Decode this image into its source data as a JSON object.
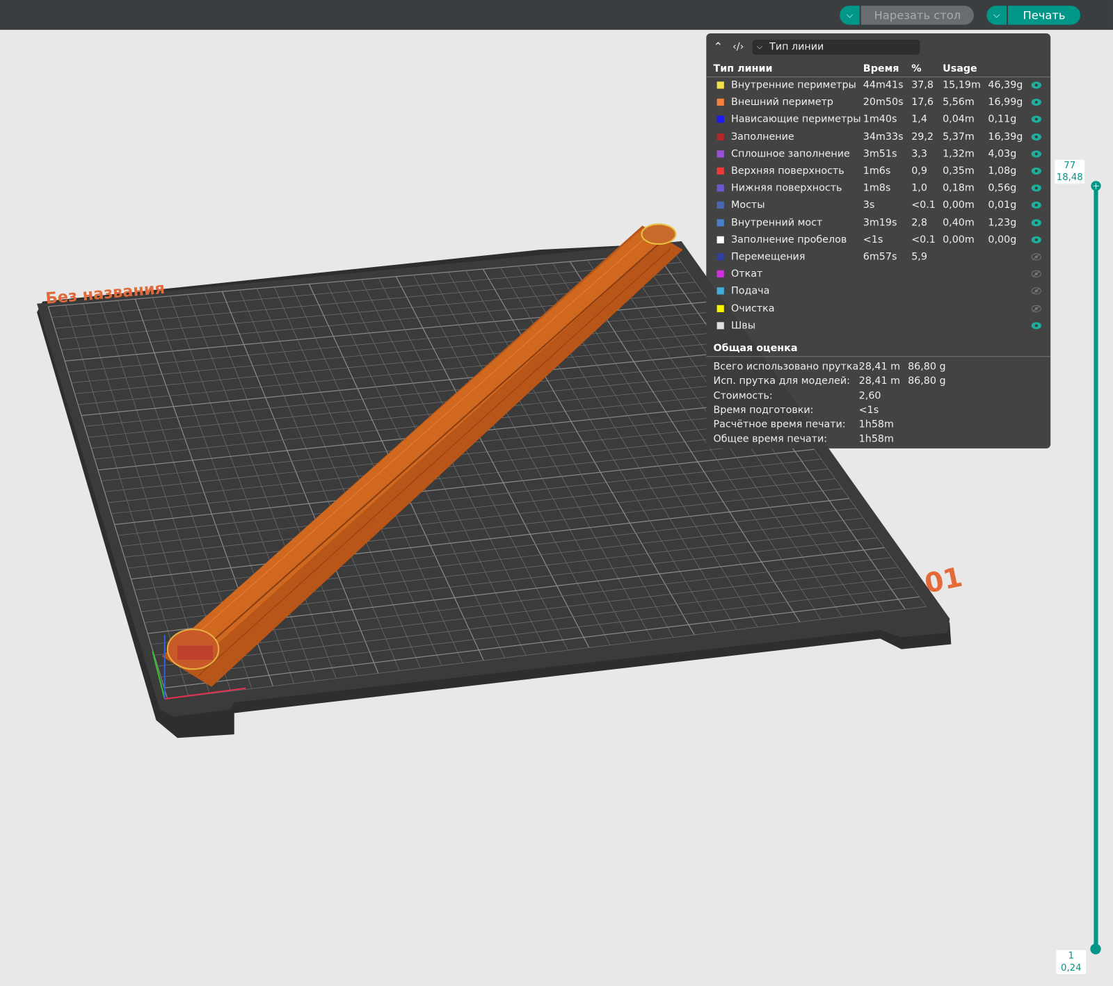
{
  "topbar": {
    "slice_label": "Нарезать стол",
    "print_label": "Печать"
  },
  "plate": {
    "name": "Без названия",
    "number": "01"
  },
  "legend": {
    "view_type": "Тип линии",
    "headers": {
      "type": "Тип линии",
      "time": "Время",
      "percent": "%",
      "usage": "Usage"
    },
    "rows": [
      {
        "color": "#f5e04a",
        "name": "Внутренние периметры",
        "time": "44m41s",
        "percent": "37,8",
        "length": "15,19m",
        "weight": "46,39g",
        "visible": true
      },
      {
        "color": "#f5813a",
        "name": "Внешний периметр",
        "time": "20m50s",
        "percent": "17,6",
        "length": "5,56m",
        "weight": "16,99g",
        "visible": true
      },
      {
        "color": "#1a1af5",
        "name": "Нависающие периметры",
        "time": "1m40s",
        "percent": "1,4",
        "length": "0,04m",
        "weight": "0,11g",
        "visible": true
      },
      {
        "color": "#b02828",
        "name": "Заполнение",
        "time": "34m33s",
        "percent": "29,2",
        "length": "5,37m",
        "weight": "16,39g",
        "visible": true
      },
      {
        "color": "#9a50d8",
        "name": "Сплошное заполнение",
        "time": "3m51s",
        "percent": "3,3",
        "length": "1,32m",
        "weight": "4,03g",
        "visible": true
      },
      {
        "color": "#f03a3a",
        "name": "Верхняя поверхность",
        "time": "1m6s",
        "percent": "0,9",
        "length": "0,35m",
        "weight": "1,08g",
        "visible": true
      },
      {
        "color": "#6a5ad0",
        "name": "Нижняя поверхность",
        "time": "1m8s",
        "percent": "1,0",
        "length": "0,18m",
        "weight": "0,56g",
        "visible": true
      },
      {
        "color": "#4a68b0",
        "name": "Мосты",
        "time": "3s",
        "percent": "<0.1",
        "length": "0,00m",
        "weight": "0,01g",
        "visible": true
      },
      {
        "color": "#4a80c8",
        "name": "Внутренний мост",
        "time": "3m19s",
        "percent": "2,8",
        "length": "0,40m",
        "weight": "1,23g",
        "visible": true
      },
      {
        "color": "#ffffff",
        "name": "Заполнение пробелов",
        "time": "<1s",
        "percent": "<0.1",
        "length": "0,00m",
        "weight": "0,00g",
        "visible": true
      },
      {
        "color": "#3040a0",
        "name": "Перемещения",
        "time": "6m57s",
        "percent": "5,9",
        "length": "",
        "weight": "",
        "visible": false
      },
      {
        "color": "#d030e0",
        "name": "Откат",
        "time": "",
        "percent": "",
        "length": "",
        "weight": "",
        "visible": false
      },
      {
        "color": "#40b0d8",
        "name": "Подача",
        "time": "",
        "percent": "",
        "length": "",
        "weight": "",
        "visible": false
      },
      {
        "color": "#f5f500",
        "name": "Очистка",
        "time": "",
        "percent": "",
        "length": "",
        "weight": "",
        "visible": false
      },
      {
        "color": "#e0e0e0",
        "name": "Швы",
        "time": "",
        "percent": "",
        "length": "",
        "weight": "",
        "visible": true
      }
    ],
    "summary_title": "Общая оценка",
    "summary": [
      {
        "label": "Всего использовано прутка:",
        "value": "28,41 m",
        "value2": "86,80 g"
      },
      {
        "label": "Исп. прутка для моделей:",
        "value": "28,41 m",
        "value2": "86,80 g"
      },
      {
        "label": "Стоимость:",
        "value": "2,60",
        "value2": ""
      },
      {
        "label": "Время подготовки:",
        "value": "<1s",
        "value2": ""
      },
      {
        "label": "Расчётное время печати:",
        "value": "1h58m",
        "value2": ""
      },
      {
        "label": "Общее время печати:",
        "value": "1h58m",
        "value2": ""
      }
    ]
  },
  "layer_slider": {
    "top_layer": "77",
    "top_height": "18,48",
    "bottom_layer": "1",
    "bottom_height": "0,24"
  },
  "colors": {
    "accent": "#009688",
    "panel": "#3c3c3c",
    "bed": "#3b3b3b",
    "model": "#c8621e"
  }
}
